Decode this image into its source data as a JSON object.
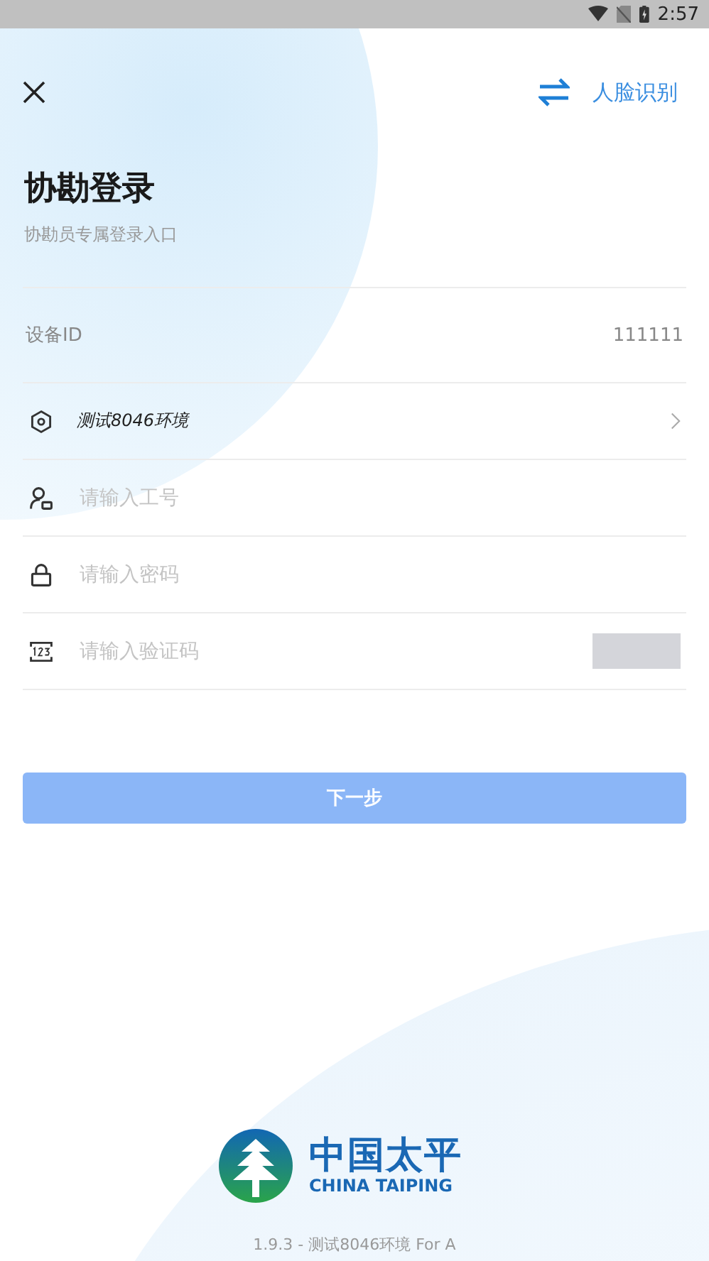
{
  "status_bar": {
    "time": "2:57"
  },
  "header": {
    "switch_label": "人脸识别"
  },
  "title": "协勘登录",
  "subtitle": "协勘员专属登录入口",
  "device": {
    "label": "设备ID",
    "value": "111111"
  },
  "fields": [
    {
      "kind": "select",
      "value": "测试8046环境"
    },
    {
      "kind": "user",
      "placeholder": "请输入工号"
    },
    {
      "kind": "password",
      "placeholder": "请输入密码"
    },
    {
      "kind": "captcha",
      "placeholder": "请输入验证码"
    }
  ],
  "submit": {
    "label": "下一步",
    "disabled": true
  },
  "logo": {
    "name": "中国太平",
    "name_en": "CHINA TAIPING"
  },
  "version": "1.9.3 - 测试8046环境 For A"
}
